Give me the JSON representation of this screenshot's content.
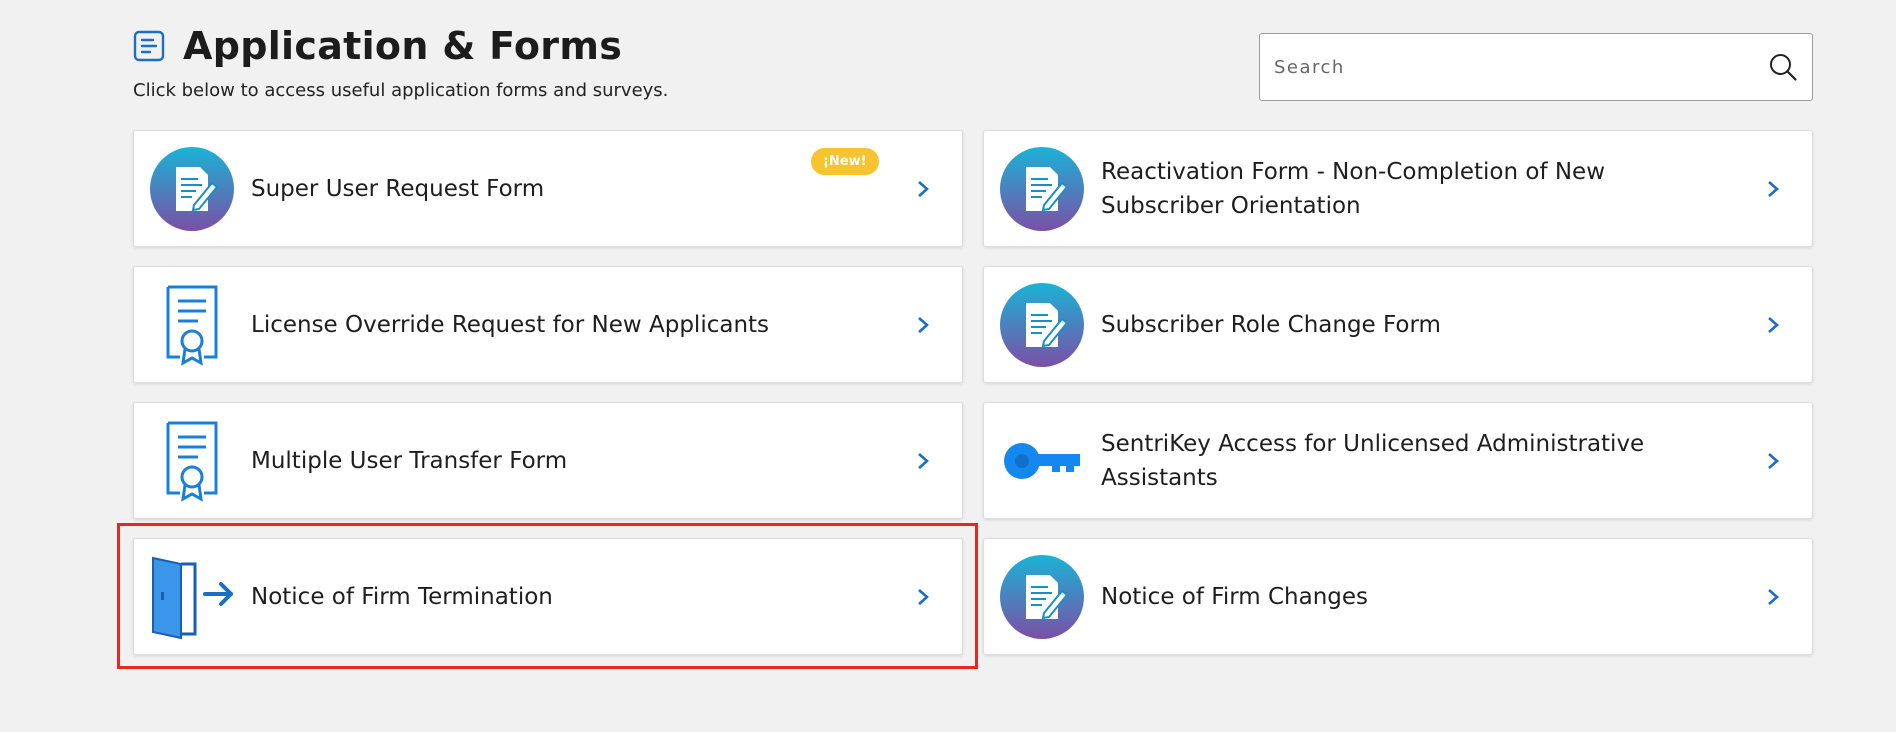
{
  "page": {
    "title": "Application & Forms",
    "subtitle": "Click below to access useful application forms and surveys."
  },
  "search": {
    "placeholder": "Search",
    "icon": "search-icon"
  },
  "cards": [
    {
      "label": "Super User Request Form",
      "icon": "document-edit-icon",
      "badge": "¡New!"
    },
    {
      "label": "Reactivation Form - Non-Completion of New Subscriber Orientation",
      "icon": "document-edit-icon"
    },
    {
      "label": "License Override Request for New Applicants",
      "icon": "certificate-icon"
    },
    {
      "label": "Subscriber Role Change Form",
      "icon": "document-edit-icon"
    },
    {
      "label": "Multiple User Transfer Form",
      "icon": "certificate-icon"
    },
    {
      "label": "SentriKey Access for Unlicensed Administrative Assistants",
      "icon": "key-icon"
    },
    {
      "label": "Notice of Firm Termination",
      "icon": "door-exit-icon",
      "highlighted": true
    },
    {
      "label": "Notice of Firm Changes",
      "icon": "document-edit-icon"
    }
  ],
  "colors": {
    "accent": "#1a6fc4",
    "badge": "#f7c32e",
    "highlight": "#e8281e",
    "gradient_top": "#1ab3d6",
    "gradient_bottom": "#7b4fa6"
  }
}
